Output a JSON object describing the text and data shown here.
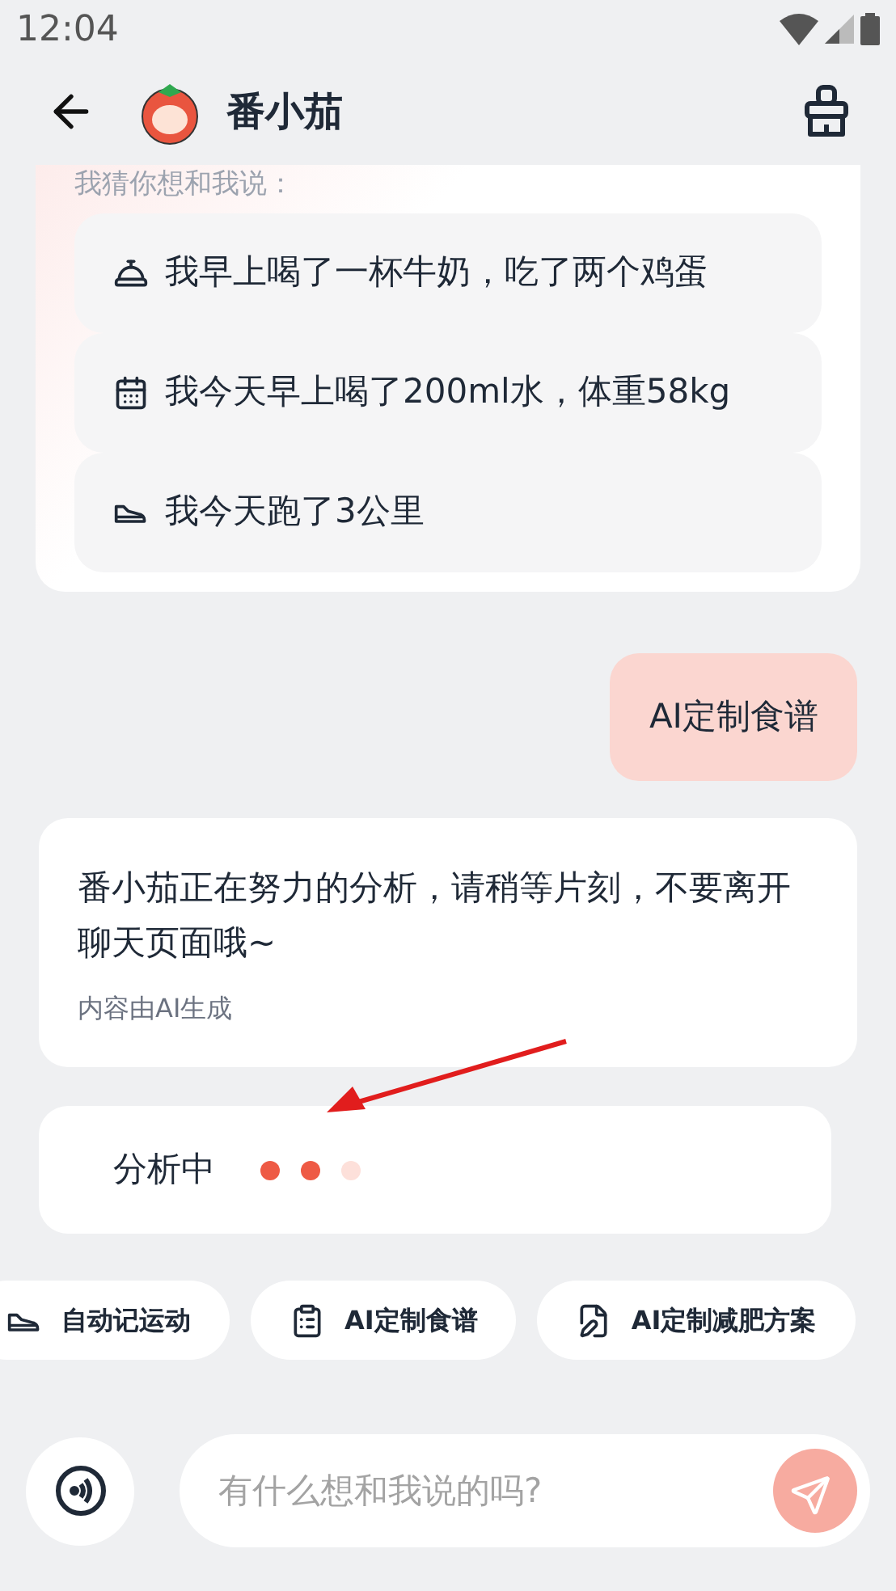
{
  "status_bar": {
    "time": "12:04"
  },
  "header": {
    "title": "番小茄"
  },
  "suggestions": {
    "heading": "我猜你想和我说：",
    "items": [
      {
        "kind": "meal",
        "text": "我早上喝了一杯牛奶，吃了两个鸡蛋"
      },
      {
        "kind": "record",
        "text": "我今天早上喝了200ml水，体重58kg"
      },
      {
        "kind": "run",
        "text": "我今天跑了3公里"
      }
    ]
  },
  "user_message": {
    "text": "AI定制食谱"
  },
  "bot_message": {
    "text": "番小茄正在努力的分析，请稍等片刻，不要离开聊天页面哦~",
    "note": "内容由AI生成"
  },
  "analyzing": {
    "label": "分析中",
    "dots": [
      {
        "on": true
      },
      {
        "on": true
      },
      {
        "on": false
      }
    ]
  },
  "chips": [
    {
      "kind": "run",
      "label": "自动记运动"
    },
    {
      "kind": "recipe",
      "label": "AI定制食谱"
    },
    {
      "kind": "plan",
      "label": "AI定制减肥方案"
    }
  ],
  "input": {
    "placeholder": "有什么想和我说的吗?"
  }
}
